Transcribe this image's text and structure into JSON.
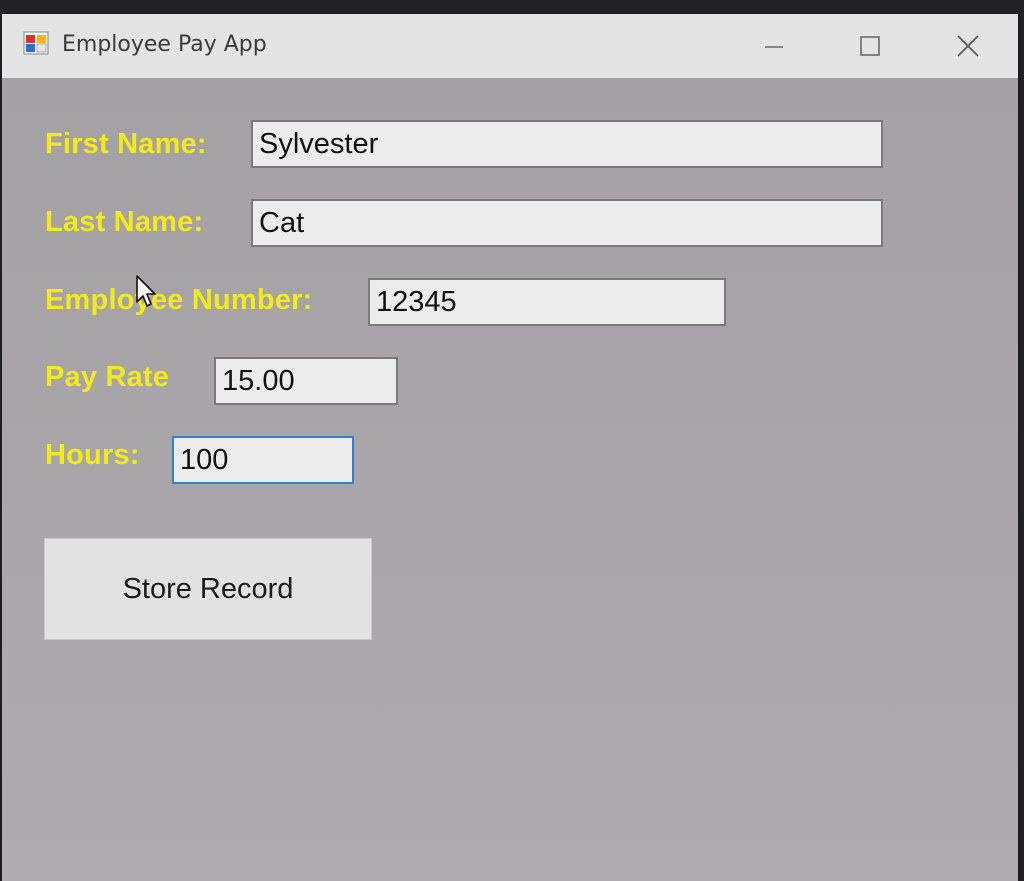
{
  "window": {
    "title": "Employee Pay App"
  },
  "colors": {
    "label": "#f3ea1a",
    "client_background": "#a9a6a9",
    "field_background": "#ececec",
    "focus_border": "#2f7fd6"
  },
  "icons": {
    "app": "app-window-icon",
    "minimize": "minimize-icon",
    "maximize": "maximize-icon",
    "close": "close-icon",
    "pointer": "mouse-pointer-icon"
  },
  "form": {
    "first_name": {
      "label": "First Name:",
      "value": "Sylvester"
    },
    "last_name": {
      "label": "Last Name:",
      "value": "Cat"
    },
    "employee_number": {
      "label": "Employee Number:",
      "value": "12345"
    },
    "pay_rate": {
      "label": "Pay Rate",
      "value": "15.00"
    },
    "hours": {
      "label": "Hours:",
      "value": "100"
    }
  },
  "actions": {
    "store_record_label": "Store Record"
  }
}
